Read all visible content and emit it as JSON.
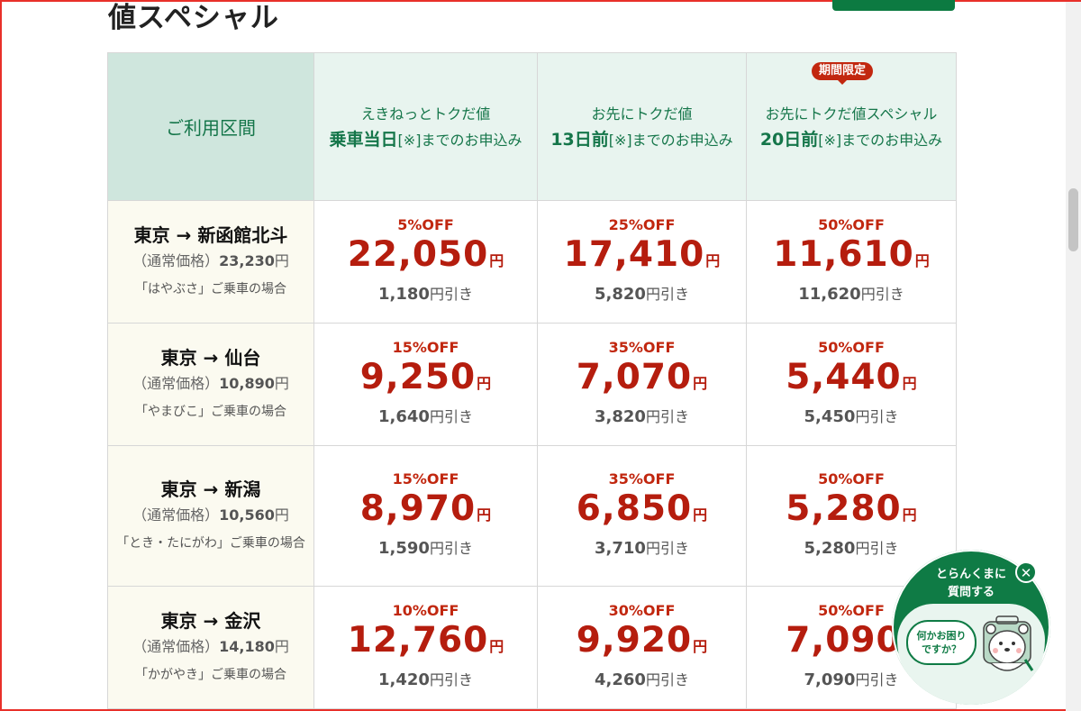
{
  "page": {
    "title": "値スペシャル"
  },
  "table": {
    "route_header": "ご利用区間",
    "plans": [
      {
        "name": "えきねっとトクだ値",
        "deadline": "乗車当日",
        "deadline_note": "[※]までのお申込み",
        "badge": ""
      },
      {
        "name": "お先にトクだ値",
        "deadline": "13日前",
        "deadline_note": "[※]までのお申込み",
        "badge": ""
      },
      {
        "name": "お先にトクだ値スペシャル",
        "deadline": "20日前",
        "deadline_note": "[※]までのお申込み",
        "badge": "期間限定"
      }
    ],
    "normal_price_prefix": "（通常価格）",
    "yen": "円",
    "saving_suffix": "円引き",
    "rows": [
      {
        "route": "東京 → 新函館北斗",
        "normal_price": "23,230",
        "note": "「はやぶさ」ご乗車の場合",
        "prices": [
          {
            "discount": "5%OFF",
            "price": "22,050",
            "saving": "1,180"
          },
          {
            "discount": "25%OFF",
            "price": "17,410",
            "saving": "5,820"
          },
          {
            "discount": "50%OFF",
            "price": "11,610",
            "saving": "11,620"
          }
        ]
      },
      {
        "route": "東京 → 仙台",
        "normal_price": "10,890",
        "note": "「やまびこ」ご乗車の場合",
        "prices": [
          {
            "discount": "15%OFF",
            "price": "9,250",
            "saving": "1,640"
          },
          {
            "discount": "35%OFF",
            "price": "7,070",
            "saving": "3,820"
          },
          {
            "discount": "50%OFF",
            "price": "5,440",
            "saving": "5,450"
          }
        ]
      },
      {
        "route": "東京 → 新潟",
        "normal_price": "10,560",
        "note": "「とき・たにがわ」ご乗車の場合",
        "prices": [
          {
            "discount": "15%OFF",
            "price": "8,970",
            "saving": "1,590"
          },
          {
            "discount": "35%OFF",
            "price": "6,850",
            "saving": "3,710"
          },
          {
            "discount": "50%OFF",
            "price": "5,280",
            "saving": "5,280"
          }
        ]
      },
      {
        "route": "東京 → 金沢",
        "normal_price": "14,180",
        "note": "「かがやき」ご乗車の場合",
        "prices": [
          {
            "discount": "10%OFF",
            "price": "12,760",
            "saving": "1,420"
          },
          {
            "discount": "30%OFF",
            "price": "9,920",
            "saving": "4,260"
          },
          {
            "discount": "50%OFF",
            "price": "7,090",
            "saving": "7,090"
          }
        ]
      }
    ]
  },
  "chat": {
    "title_line1": "とらんくまに",
    "title_line2": "質問する",
    "bubble_line1": "何かお困り",
    "bubble_line2": "ですか？",
    "close_glyph": "✕"
  },
  "colors": {
    "accent_green": "#0f7b45",
    "price_red": "#b51d0e",
    "header_green": "#cfe6dd"
  }
}
